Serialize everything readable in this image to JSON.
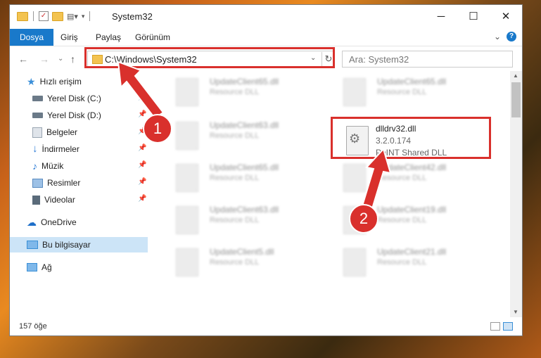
{
  "window": {
    "title": "System32",
    "controls": {
      "minimize": "─",
      "maximize": "☐",
      "close": "✕"
    }
  },
  "ribbon": {
    "tabs": [
      "Dosya",
      "Giriş",
      "Paylaş",
      "Görünüm"
    ],
    "expand": "⌄",
    "help": "?"
  },
  "nav": {
    "back": "←",
    "forward": "→",
    "recent": "⌄",
    "up": "↑"
  },
  "address": {
    "path": "C:\\Windows\\System32",
    "dropdown": "⌄",
    "refresh": "↻"
  },
  "search": {
    "placeholder": "Ara: System32"
  },
  "sidebar": {
    "items": [
      {
        "label": "Hızlı erişim",
        "icon": "star-icon",
        "color": "#3b8fd9"
      },
      {
        "label": "Yerel Disk (C:)",
        "icon": "drive-icon",
        "color": "#6b7a88",
        "pinned": true
      },
      {
        "label": "Yerel Disk (D:)",
        "icon": "drive-icon",
        "color": "#6b7a88",
        "pinned": true
      },
      {
        "label": "Belgeler",
        "icon": "documents-icon",
        "color": "#9aa6b2",
        "pinned": true
      },
      {
        "label": "İndirmeler",
        "icon": "download-icon",
        "color": "#2b7bd6",
        "pinned": true
      },
      {
        "label": "Müzik",
        "icon": "music-icon",
        "color": "#2b7bd6",
        "pinned": true
      },
      {
        "label": "Resimler",
        "icon": "pictures-icon",
        "color": "#5a8bc0",
        "pinned": true
      },
      {
        "label": "Videolar",
        "icon": "videos-icon",
        "color": "#5a6b7a",
        "pinned": true
      },
      {
        "label": "OneDrive",
        "icon": "cloud-icon",
        "color": "#1e6fc9"
      },
      {
        "label": "Bu bilgisayar",
        "icon": "computer-icon",
        "color": "#3a8fd6",
        "selected": true
      },
      {
        "label": "Ağ",
        "icon": "network-icon",
        "color": "#3a8fd6"
      }
    ]
  },
  "files": {
    "left": [
      {
        "name": "UpdateClient65.dll",
        "desc": "Resource DLL"
      },
      {
        "name": "UpdateClient63.dll",
        "desc": "Resource DLL"
      },
      {
        "name": "UpdateClient65.dll",
        "desc": "Resource DLL"
      },
      {
        "name": "UpdateClient63.dll",
        "desc": "Resource DLL"
      },
      {
        "name": "UpdateClient5.dll",
        "desc": "Resource DLL"
      }
    ],
    "right": [
      {
        "name": "UpdateClient65.dll",
        "desc": "Resource DLL"
      },
      {
        "name": "UpdateClient42.dll",
        "desc": "Resource DLL"
      },
      {
        "name": "UpdateClient19.dll",
        "desc": "Resource DLL"
      },
      {
        "name": "UpdateClient21.dll",
        "desc": "Resource DLL"
      }
    ],
    "highlighted": {
      "name": "dlldrv32.dll",
      "version": "3.2.0.174",
      "desc": "PoINT Shared DLL"
    }
  },
  "status": {
    "count": "157 öğe"
  },
  "annotations": {
    "step1": "1",
    "step2": "2",
    "accent": "#d9302c"
  }
}
